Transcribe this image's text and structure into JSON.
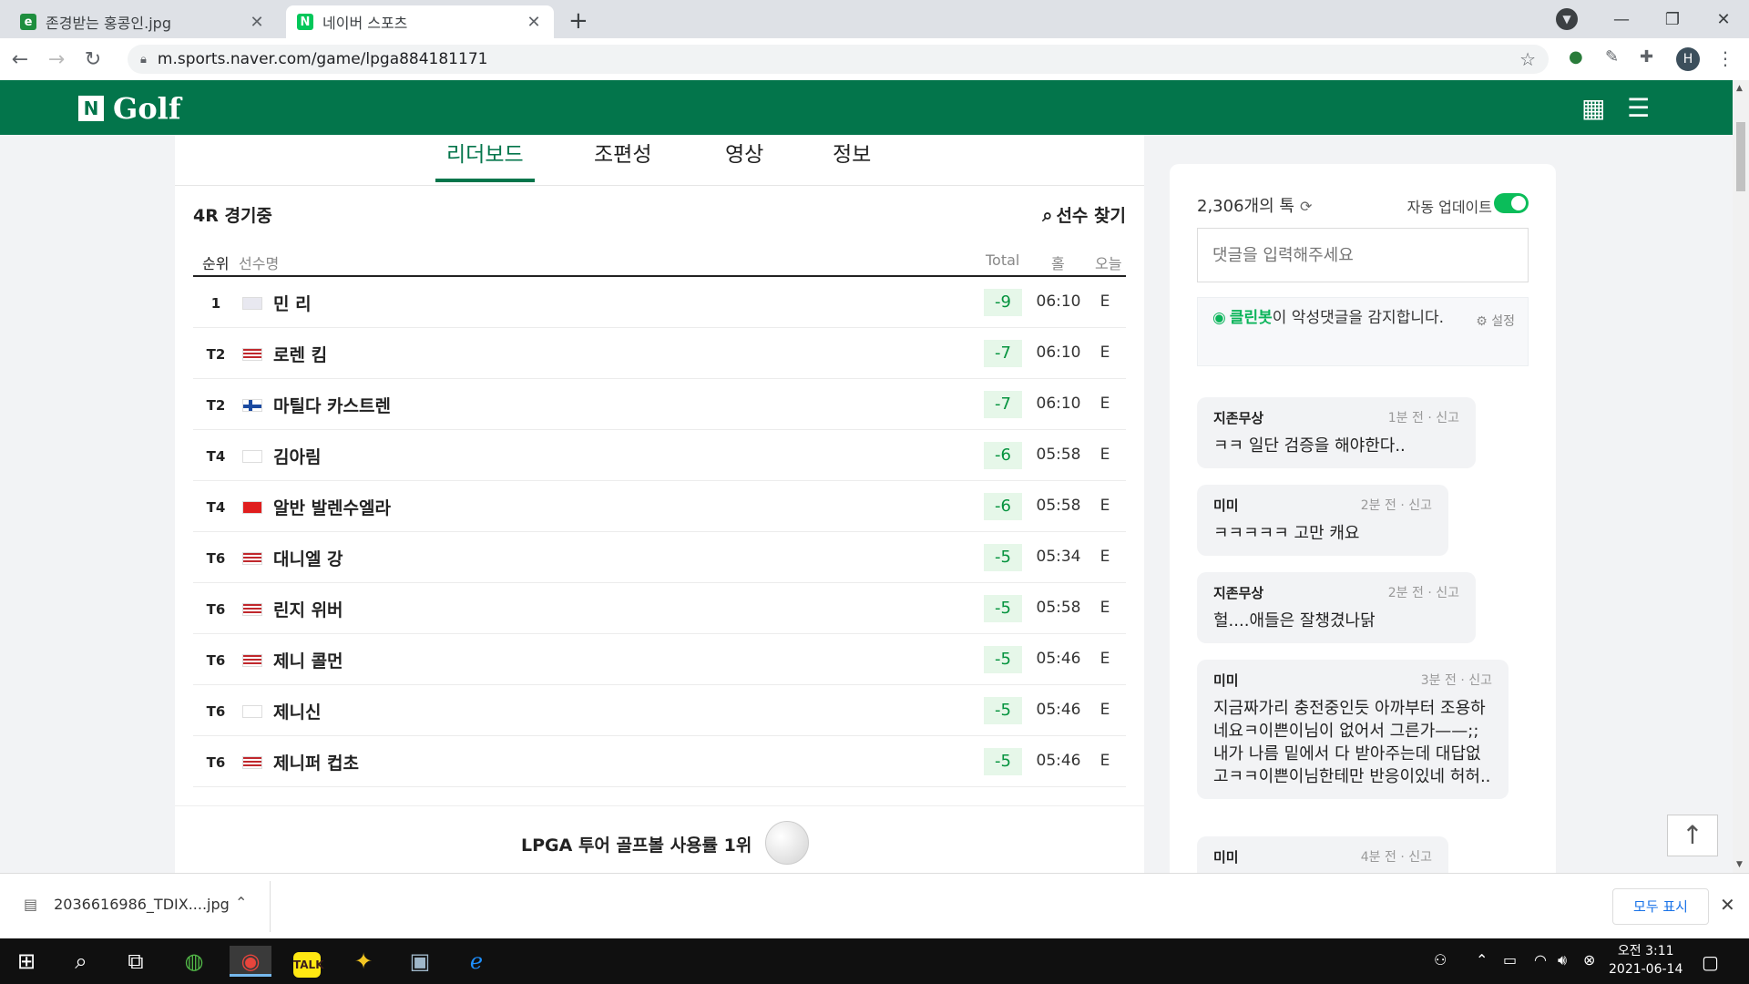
{
  "browser": {
    "tabs": [
      {
        "title": "존경받는 홍콩인.jpg",
        "favicon": "e",
        "favicon_color": "#1e8e3e"
      },
      {
        "title": "네이버 스포츠",
        "favicon": "N",
        "favicon_color": "#03c75a"
      }
    ],
    "url": "m.sports.naver.com/game/lpga884181171",
    "profile_initial": "H"
  },
  "header": {
    "logo_mark": "N",
    "logo_text": "Golf"
  },
  "page_tabs": [
    "리더보드",
    "조편성",
    "영상",
    "정보"
  ],
  "round_status": "4R 경기중",
  "find_player": "선수 찾기",
  "columns": {
    "rank": "순위",
    "player": "선수명",
    "total": "Total",
    "hole": "홀",
    "today": "오늘"
  },
  "leaderboard": [
    {
      "rank": "1",
      "flag": "th",
      "name": "민 리",
      "total": "-9",
      "hole": "06:10",
      "today": "E"
    },
    {
      "rank": "T2",
      "flag": "us",
      "name": "로렌 킴",
      "total": "-7",
      "hole": "06:10",
      "today": "E"
    },
    {
      "rank": "T2",
      "flag": "fi",
      "name": "마틸다 카스트렌",
      "total": "-7",
      "hole": "06:10",
      "today": "E"
    },
    {
      "rank": "T4",
      "flag": "kr",
      "name": "김아림",
      "total": "-6",
      "hole": "05:58",
      "today": "E"
    },
    {
      "rank": "T4",
      "flag": "ch",
      "name": "알반 발렌수엘라",
      "total": "-6",
      "hole": "05:58",
      "today": "E"
    },
    {
      "rank": "T6",
      "flag": "us",
      "name": "대니엘 강",
      "total": "-5",
      "hole": "05:34",
      "today": "E"
    },
    {
      "rank": "T6",
      "flag": "us",
      "name": "린지 위버",
      "total": "-5",
      "hole": "05:58",
      "today": "E"
    },
    {
      "rank": "T6",
      "flag": "us",
      "name": "제니 콜먼",
      "total": "-5",
      "hole": "05:46",
      "today": "E"
    },
    {
      "rank": "T6",
      "flag": "kr",
      "name": "제니신",
      "total": "-5",
      "hole": "05:46",
      "today": "E"
    },
    {
      "rank": "T6",
      "flag": "us",
      "name": "제니퍼 컵초",
      "total": "-5",
      "hole": "05:46",
      "today": "E"
    }
  ],
  "promo": "LPGA 투어 골프볼 사용률 1위",
  "talk": {
    "count": "2,306개의 톡",
    "auto_update": "자동 업데이트",
    "input_placeholder": "댓글을 입력해주세요",
    "cleanbot_name": "클린봇",
    "cleanbot_text": "이 악성댓글을 감지합니다.",
    "cleanbot_settings": "설정",
    "comments": [
      {
        "user": "지존무상",
        "meta": "1분 전 · 신고",
        "text": "ㅋㅋ 일단 검증을 해야한다.."
      },
      {
        "user": "미미",
        "meta": "2분 전 · 신고",
        "text": "ㅋㅋㅋㅋㅋ 고만 캐요"
      },
      {
        "user": "지존무상",
        "meta": "2분 전 · 신고",
        "text": "헐....애들은 잘챙겼나닭"
      },
      {
        "user": "미미",
        "meta": "3분 전 · 신고",
        "text": "지금짜가리 충전중인듯 아까부터 조용하네요ㅋ이쁜이님이 없어서 그른가——;; 내가 나름 밑에서 다 받아주는데 대답없고ㅋㅋ이쁜이님한테만 반응이있네 허허.."
      },
      {
        "user": "미미",
        "meta": "4분 전 · 신고",
        "text": ""
      }
    ]
  },
  "download": {
    "file": "2036616986_TDIX....jpg",
    "show_all": "모두 표시"
  },
  "taskbar": {
    "time": "오전 3:11",
    "date": "2021-06-14",
    "kakao": "TALK"
  }
}
